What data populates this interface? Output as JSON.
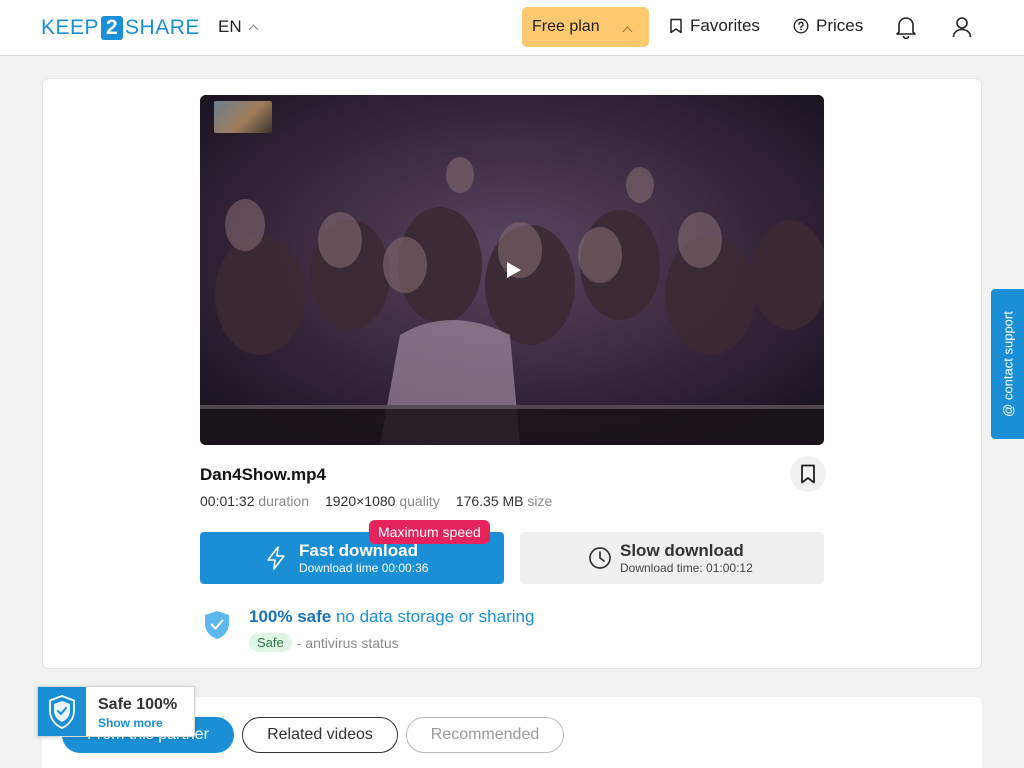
{
  "colors": {
    "brand": "#1a8fd6",
    "plan": "#fcc870",
    "badge": "#e5245c"
  },
  "header": {
    "logo": {
      "part1": "KEEP",
      "part2": "2",
      "part3": "SHARE"
    },
    "language": "EN",
    "plan": "Free plan",
    "favorites": "Favorites",
    "prices": "Prices",
    "icons": [
      "bell-icon",
      "user-icon",
      "bookmark-icon",
      "help-circle-icon"
    ]
  },
  "file": {
    "name": "Dan4Show.mp4",
    "duration_value": "00:01:32",
    "duration_label": "duration",
    "quality_value": "1920×1080",
    "quality_label": "quality",
    "size_value": "176.35 MB",
    "size_label": "size"
  },
  "fast_download": {
    "title": "Fast download",
    "subtitle": "Download time 00:00:36",
    "badge": "Maximum speed"
  },
  "slow_download": {
    "title": "Slow download",
    "subtitle": "Download time: 01:00:12"
  },
  "safety": {
    "bold": "100% safe",
    "rest": "no data storage or sharing",
    "badge": "Safe",
    "status": "- antivirus status"
  },
  "contact_support": "@ contact support",
  "tabs": [
    {
      "label": "From this partner",
      "active": true
    },
    {
      "label": "Related videos",
      "active": false
    },
    {
      "label": "Recommended",
      "active": false
    }
  ],
  "safe_widget": {
    "title": "Safe 100%",
    "link": "Show more"
  }
}
